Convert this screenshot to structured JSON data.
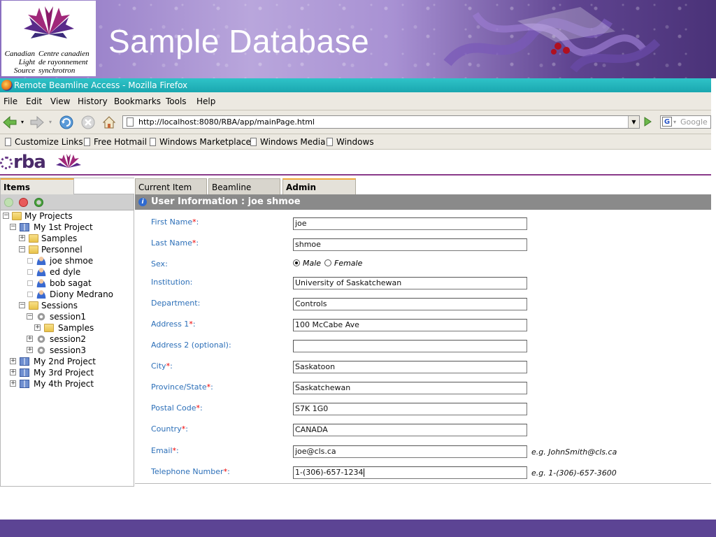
{
  "slide": {
    "title": "Sample Database",
    "logo_left": [
      "Canadian",
      "Light",
      "Source"
    ],
    "logo_right": [
      "Centre canadien",
      "de rayonnement",
      "synchrotron"
    ]
  },
  "browser": {
    "window_title": "Remote Beamline Access - Mozilla Firefox",
    "menu": [
      "File",
      "Edit",
      "View",
      "History",
      "Bookmarks",
      "Tools",
      "Help"
    ],
    "url": "http://localhost:8080/RBA/app/mainPage.html",
    "search_placeholder": "Google",
    "links": [
      "Customize Links",
      "Free Hotmail",
      "Windows Marketplace",
      "Windows Media",
      "Windows"
    ]
  },
  "app": {
    "logo": "rba",
    "items_tab": "Items",
    "tabs": [
      "Current Item",
      "Beamline",
      "Admin"
    ],
    "active_tab": "Admin",
    "tree": [
      {
        "label": "My Projects"
      },
      {
        "label": "My 1st Project"
      },
      {
        "label": "Samples"
      },
      {
        "label": "Personnel"
      },
      {
        "label": "joe shmoe"
      },
      {
        "label": "ed dyle"
      },
      {
        "label": "bob sagat"
      },
      {
        "label": "Diony Medrano"
      },
      {
        "label": "Sessions"
      },
      {
        "label": "session1"
      },
      {
        "label": "Samples"
      },
      {
        "label": "session2"
      },
      {
        "label": "session3"
      },
      {
        "label": "My 2nd Project"
      },
      {
        "label": "My 3rd Project"
      },
      {
        "label": "My 4th Project"
      }
    ],
    "form": {
      "header": "User Information : joe shmoe",
      "fields": [
        {
          "label": "First Name",
          "required": true,
          "value": "joe"
        },
        {
          "label": "Last Name",
          "required": true,
          "value": "shmoe"
        },
        {
          "label": "Sex",
          "required": false,
          "options": [
            "Male",
            "Female"
          ],
          "selected": "Male"
        },
        {
          "label": "Institution:",
          "required": false,
          "value": "University of Saskatchewan"
        },
        {
          "label": "Department:",
          "required": false,
          "value": "Controls"
        },
        {
          "label": "Address 1",
          "required": true,
          "value": "100 McCabe Ave"
        },
        {
          "label": "Address 2 (optional):",
          "required": false,
          "value": ""
        },
        {
          "label": "City",
          "required": true,
          "value": "Saskatoon"
        },
        {
          "label": "Province/State",
          "required": true,
          "value": "Saskatchewan"
        },
        {
          "label": "Postal Code",
          "required": true,
          "value": "S7K 1G0"
        },
        {
          "label": "Country",
          "required": true,
          "value": "CANADA"
        },
        {
          "label": "Email",
          "required": true,
          "value": "joe@cls.ca",
          "hint": "e.g. JohnSmith@cls.ca"
        },
        {
          "label": "Telephone Number",
          "required": true,
          "value": "1-(306)-657-1234",
          "hint": "e.g. 1-(306)-657-3600"
        }
      ]
    }
  },
  "colors": {
    "accent_orange": "#f3a73a",
    "label_blue": "#2c6fb8",
    "required_red": "#e00000",
    "banner_purple": "#6a4a9a",
    "titlebar_teal": "#1aa7b0"
  }
}
